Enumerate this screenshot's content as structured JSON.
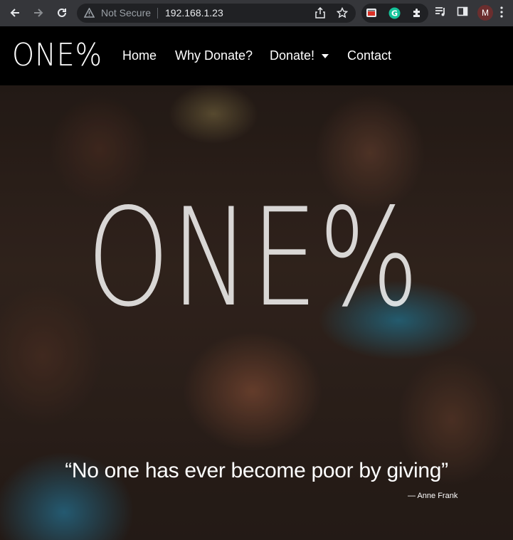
{
  "browser": {
    "security_label": "Not Secure",
    "url": "192.168.1.23",
    "profile_initial": "M",
    "icons": {
      "back": "arrow-left-icon",
      "forward": "arrow-right-icon",
      "reload": "reload-icon",
      "warning": "warning-triangle-icon",
      "share": "share-icon",
      "bookmark": "star-icon",
      "extensions": [
        "ext-window-icon",
        "grammarly-icon",
        "puzzle-icon"
      ],
      "media": "media-queue-icon",
      "side_panel": "side-panel-icon",
      "menu": "kebab-menu-icon"
    }
  },
  "site": {
    "logo": "ONE%",
    "nav": {
      "home": "Home",
      "why_donate": "Why Donate?",
      "donate": "Donate!",
      "contact": "Contact"
    }
  },
  "hero": {
    "logo": "ONE%",
    "quote": "“No one has ever become poor by giving”",
    "author": "— Anne Frank"
  },
  "colors": {
    "chrome_bg": "#35363a",
    "omnibox_bg": "#202124",
    "nav_bg": "#000000",
    "text": "#ffffff",
    "grammarly": "#15c39a"
  }
}
